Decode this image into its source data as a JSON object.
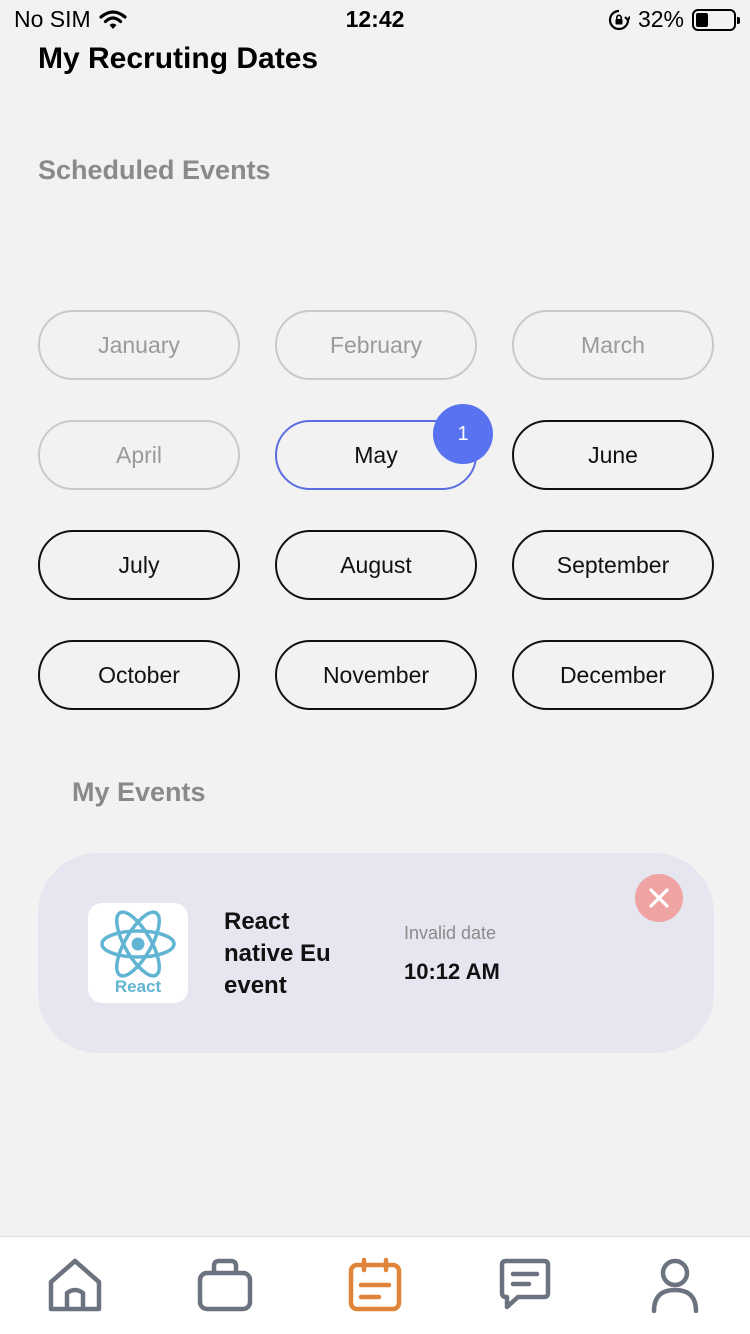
{
  "status": {
    "carrier": "No SIM",
    "time": "12:42",
    "battery": "32%",
    "battery_level": 0.32
  },
  "page": {
    "title": "My Recruting Dates"
  },
  "scheduled": {
    "title": "Scheduled Events"
  },
  "months": [
    {
      "label": "January",
      "state": "disabled"
    },
    {
      "label": "February",
      "state": "disabled"
    },
    {
      "label": "March",
      "state": "disabled"
    },
    {
      "label": "April",
      "state": "disabled"
    },
    {
      "label": "May",
      "state": "selected",
      "badge": "1"
    },
    {
      "label": "June",
      "state": "active"
    },
    {
      "label": "July",
      "state": "active"
    },
    {
      "label": "August",
      "state": "active"
    },
    {
      "label": "September",
      "state": "active"
    },
    {
      "label": "October",
      "state": "active"
    },
    {
      "label": "November",
      "state": "active"
    },
    {
      "label": "December",
      "state": "active"
    }
  ],
  "my_events": {
    "title": "My Events",
    "items": [
      {
        "logo_text": "React",
        "name": "React native Eu event",
        "date": "Invalid date",
        "time": "10:12 AM"
      }
    ]
  },
  "tabs": [
    {
      "icon": "home-icon",
      "active": false
    },
    {
      "icon": "briefcase-icon",
      "active": false
    },
    {
      "icon": "calendar-icon",
      "active": true
    },
    {
      "icon": "chat-icon",
      "active": false
    },
    {
      "icon": "profile-icon",
      "active": false
    }
  ],
  "colors": {
    "accent": "#5872f0",
    "tab_active": "#e0843a",
    "tab_inactive": "#6b7280",
    "close": "#f0a3a3",
    "card": "#e5e6f0"
  }
}
